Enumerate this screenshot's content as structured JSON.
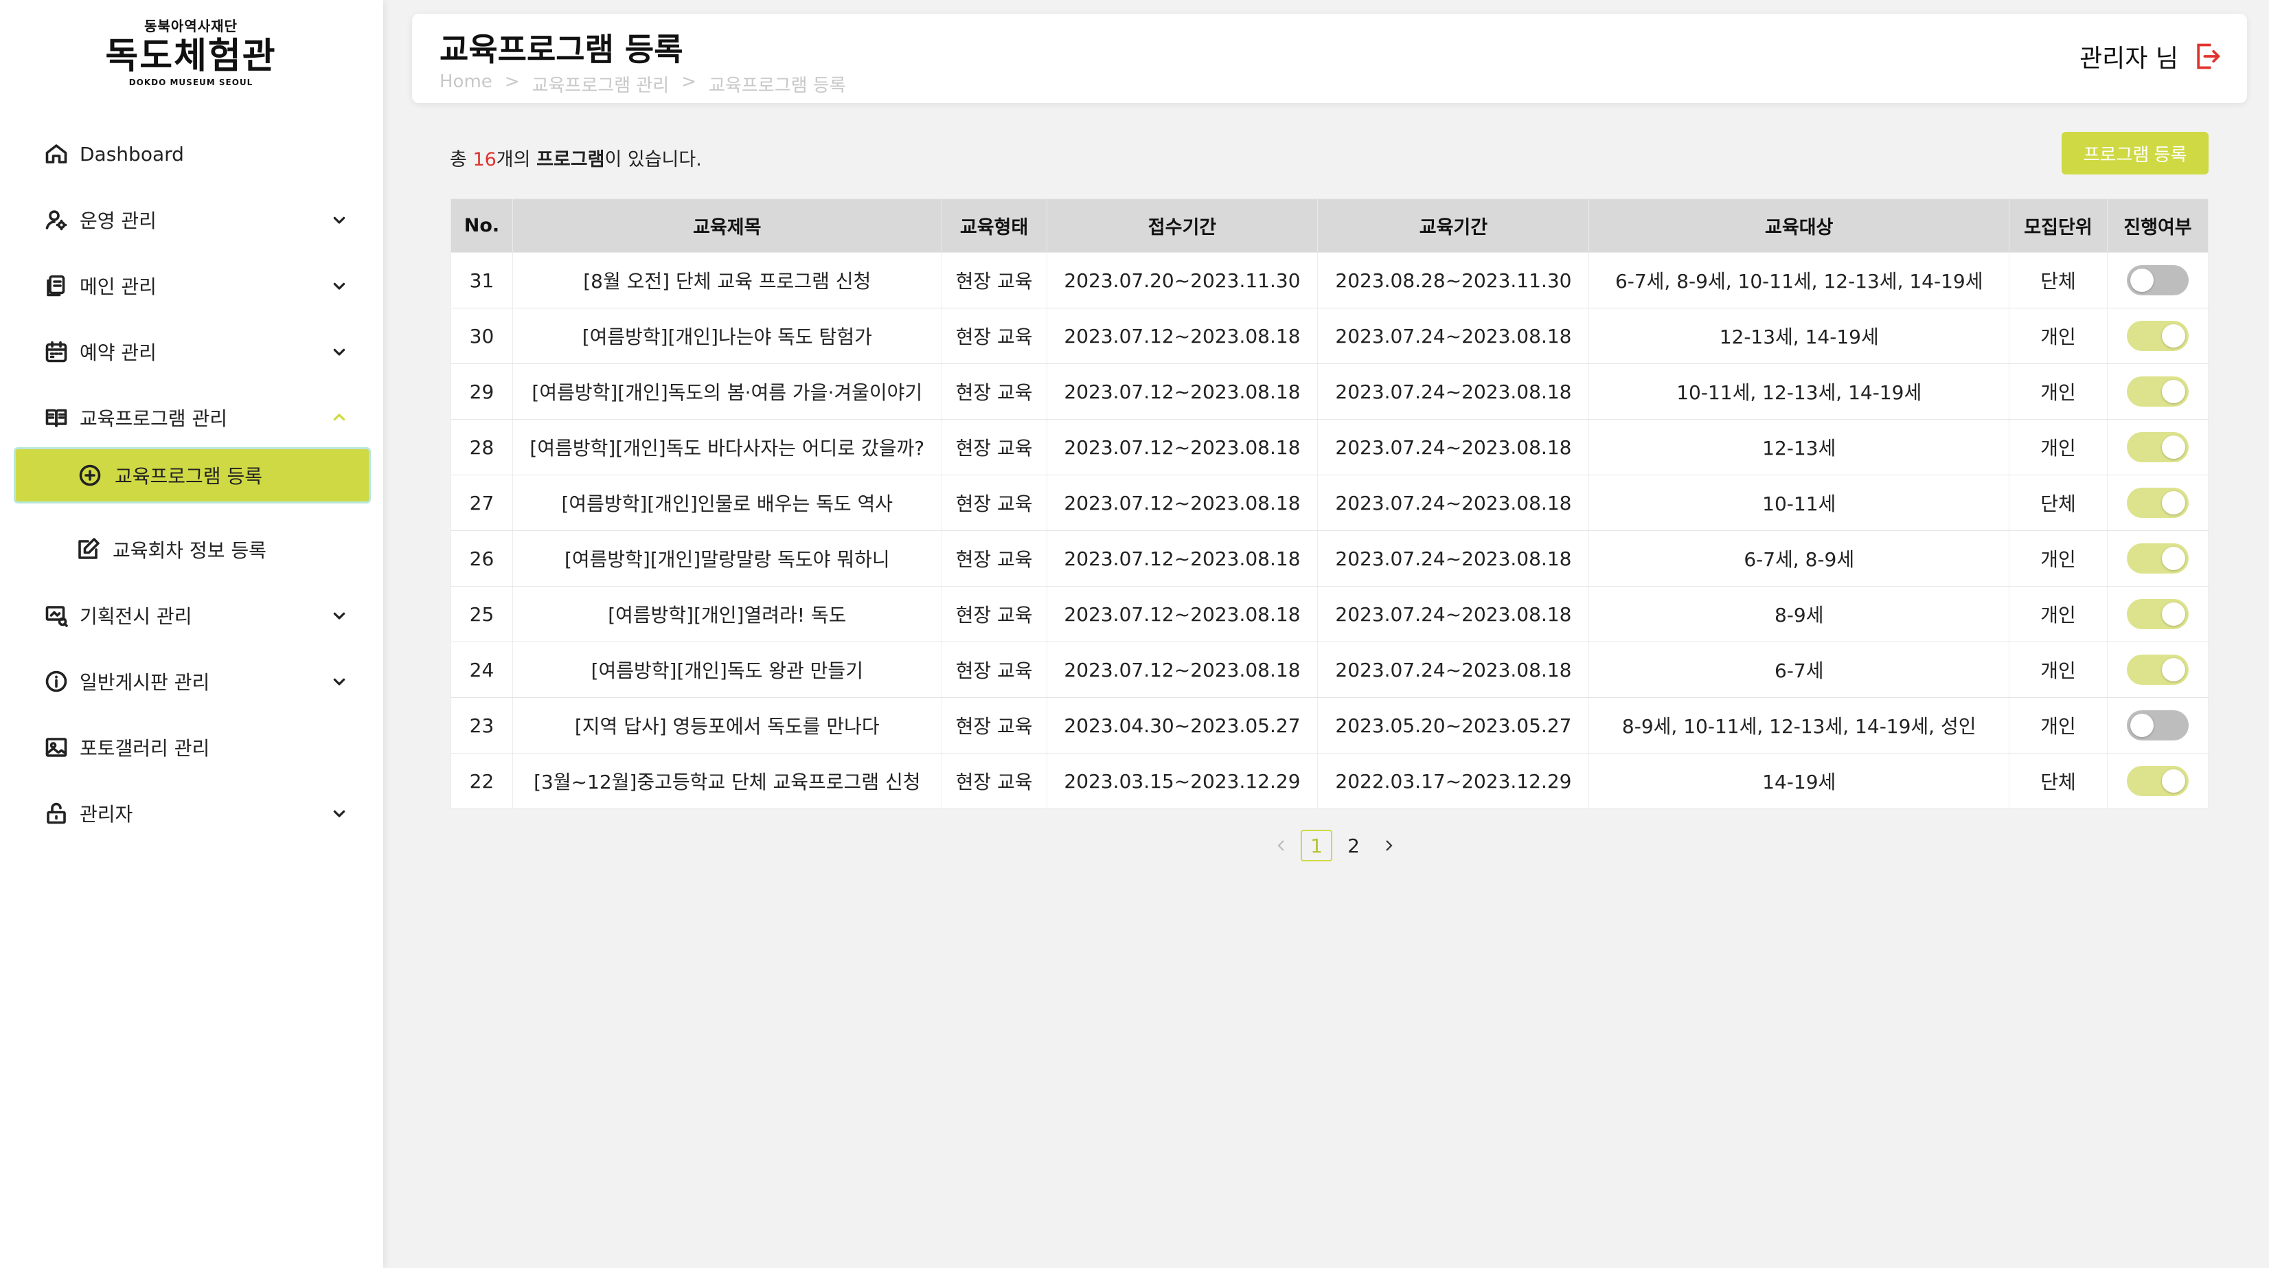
{
  "logo": {
    "top": "동북아역사재단",
    "main": "독도체험관",
    "sub": "DOKDO MUSEUM SEOUL"
  },
  "sidebar": {
    "items": [
      {
        "label": "Dashboard",
        "icon": "home-icon",
        "chevron": ""
      },
      {
        "label": "운영 관리",
        "icon": "user-settings-icon",
        "chevron": "down"
      },
      {
        "label": "메인 관리",
        "icon": "copy-icon",
        "chevron": "down"
      },
      {
        "label": "예약 관리",
        "icon": "calendar-icon",
        "chevron": "down"
      },
      {
        "label": "교육프로그램 관리",
        "icon": "book-icon",
        "chevron": "up"
      },
      {
        "label": "교육프로그램 등록",
        "icon": "plus-circle-icon",
        "chevron": ""
      },
      {
        "label": "교육회차 정보 등록",
        "icon": "edit-icon",
        "chevron": ""
      },
      {
        "label": "기획전시 관리",
        "icon": "exhibition-icon",
        "chevron": "down"
      },
      {
        "label": "일반게시판 관리",
        "icon": "info-icon",
        "chevron": "down"
      },
      {
        "label": "포토갤러리 관리",
        "icon": "image-icon",
        "chevron": ""
      },
      {
        "label": "관리자",
        "icon": "lock-icon",
        "chevron": "down"
      }
    ]
  },
  "header": {
    "title": "교육프로그램 등록",
    "breadcrumb": [
      "Home",
      "교육프로그램 관리",
      "교육프로그램 등록"
    ],
    "breadcrumb_sep": ">",
    "user": "관리자 님"
  },
  "summary": {
    "prefix": "총 ",
    "count": "16",
    "middle": "개의 ",
    "bold": "프로그램",
    "suffix": "이 있습니다."
  },
  "register_button": "프로그램 등록",
  "table": {
    "columns": [
      "No.",
      "교육제목",
      "교육형태",
      "접수기간",
      "교육기간",
      "교육대상",
      "모집단위",
      "진행여부"
    ],
    "rows": [
      {
        "no": "31",
        "title": "[8월 오전] 단체 교육 프로그램 신청",
        "type": "현장 교육",
        "apply": "2023.07.20~2023.11.30",
        "period": "2023.08.28~2023.11.30",
        "target": "6-7세, 8-9세, 10-11세, 12-13세, 14-19세",
        "unit": "단체",
        "active": false
      },
      {
        "no": "30",
        "title": "[여름방학][개인]나는야 독도 탐험가",
        "type": "현장 교육",
        "apply": "2023.07.12~2023.08.18",
        "period": "2023.07.24~2023.08.18",
        "target": "12-13세, 14-19세",
        "unit": "개인",
        "active": true
      },
      {
        "no": "29",
        "title": "[여름방학][개인]독도의 봄·여름 가을·겨울이야기",
        "type": "현장 교육",
        "apply": "2023.07.12~2023.08.18",
        "period": "2023.07.24~2023.08.18",
        "target": "10-11세, 12-13세, 14-19세",
        "unit": "개인",
        "active": true
      },
      {
        "no": "28",
        "title": "[여름방학][개인]독도 바다사자는 어디로 갔을까?",
        "type": "현장 교육",
        "apply": "2023.07.12~2023.08.18",
        "period": "2023.07.24~2023.08.18",
        "target": "12-13세",
        "unit": "개인",
        "active": true
      },
      {
        "no": "27",
        "title": "[여름방학][개인]인물로 배우는 독도 역사",
        "type": "현장 교육",
        "apply": "2023.07.12~2023.08.18",
        "period": "2023.07.24~2023.08.18",
        "target": "10-11세",
        "unit": "단체",
        "active": true
      },
      {
        "no": "26",
        "title": "[여름방학][개인]말랑말랑 독도야 뭐하니",
        "type": "현장 교육",
        "apply": "2023.07.12~2023.08.18",
        "period": "2023.07.24~2023.08.18",
        "target": "6-7세, 8-9세",
        "unit": "개인",
        "active": true
      },
      {
        "no": "25",
        "title": "[여름방학][개인]열려라! 독도",
        "type": "현장 교육",
        "apply": "2023.07.12~2023.08.18",
        "period": "2023.07.24~2023.08.18",
        "target": "8-9세",
        "unit": "개인",
        "active": true
      },
      {
        "no": "24",
        "title": "[여름방학][개인]독도 왕관 만들기",
        "type": "현장 교육",
        "apply": "2023.07.12~2023.08.18",
        "period": "2023.07.24~2023.08.18",
        "target": "6-7세",
        "unit": "개인",
        "active": true
      },
      {
        "no": "23",
        "title": "[지역 답사] 영등포에서 독도를 만나다",
        "type": "현장 교육",
        "apply": "2023.04.30~2023.05.27",
        "period": "2023.05.20~2023.05.27",
        "target": "8-9세, 10-11세, 12-13세, 14-19세, 성인",
        "unit": "개인",
        "active": false
      },
      {
        "no": "22",
        "title": "[3월~12월]중고등학교 단체 교육프로그램 신청",
        "type": "현장 교육",
        "apply": "2023.03.15~2023.12.29",
        "period": "2022.03.17~2023.12.29",
        "target": "14-19세",
        "unit": "단체",
        "active": true
      }
    ]
  },
  "pagination": {
    "pages": [
      "1",
      "2"
    ],
    "current": "1"
  },
  "colors": {
    "accent": "#cfd944",
    "count_red": "#e0332e",
    "toggle_on": "#dde38c",
    "toggle_off": "#bdbdbd",
    "logout": "#e0332e"
  }
}
